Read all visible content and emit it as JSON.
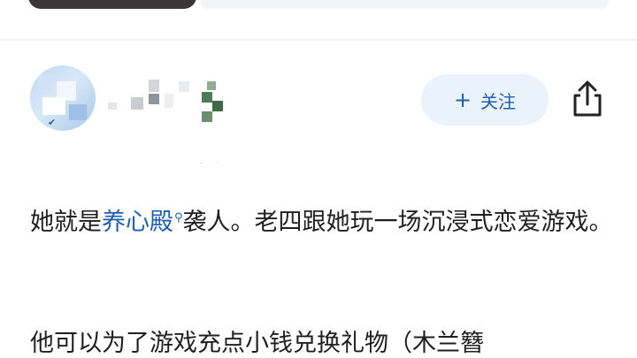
{
  "follow": {
    "label": "关注",
    "icon": "plus-icon"
  },
  "share": {
    "icon": "share-icon"
  },
  "post": {
    "p1_prefix": "她就是",
    "p1_link": "养心殿",
    "p1_suffix": "袭人。老四跟她玩一场沉浸式恋爱游戏。",
    "p2": "他可以为了游戏充点小钱兑换礼物（木兰簪"
  },
  "colors": {
    "accent": "#1f5fb3",
    "follow_bg": "#eaf2fc",
    "text": "#1f1f1f"
  }
}
